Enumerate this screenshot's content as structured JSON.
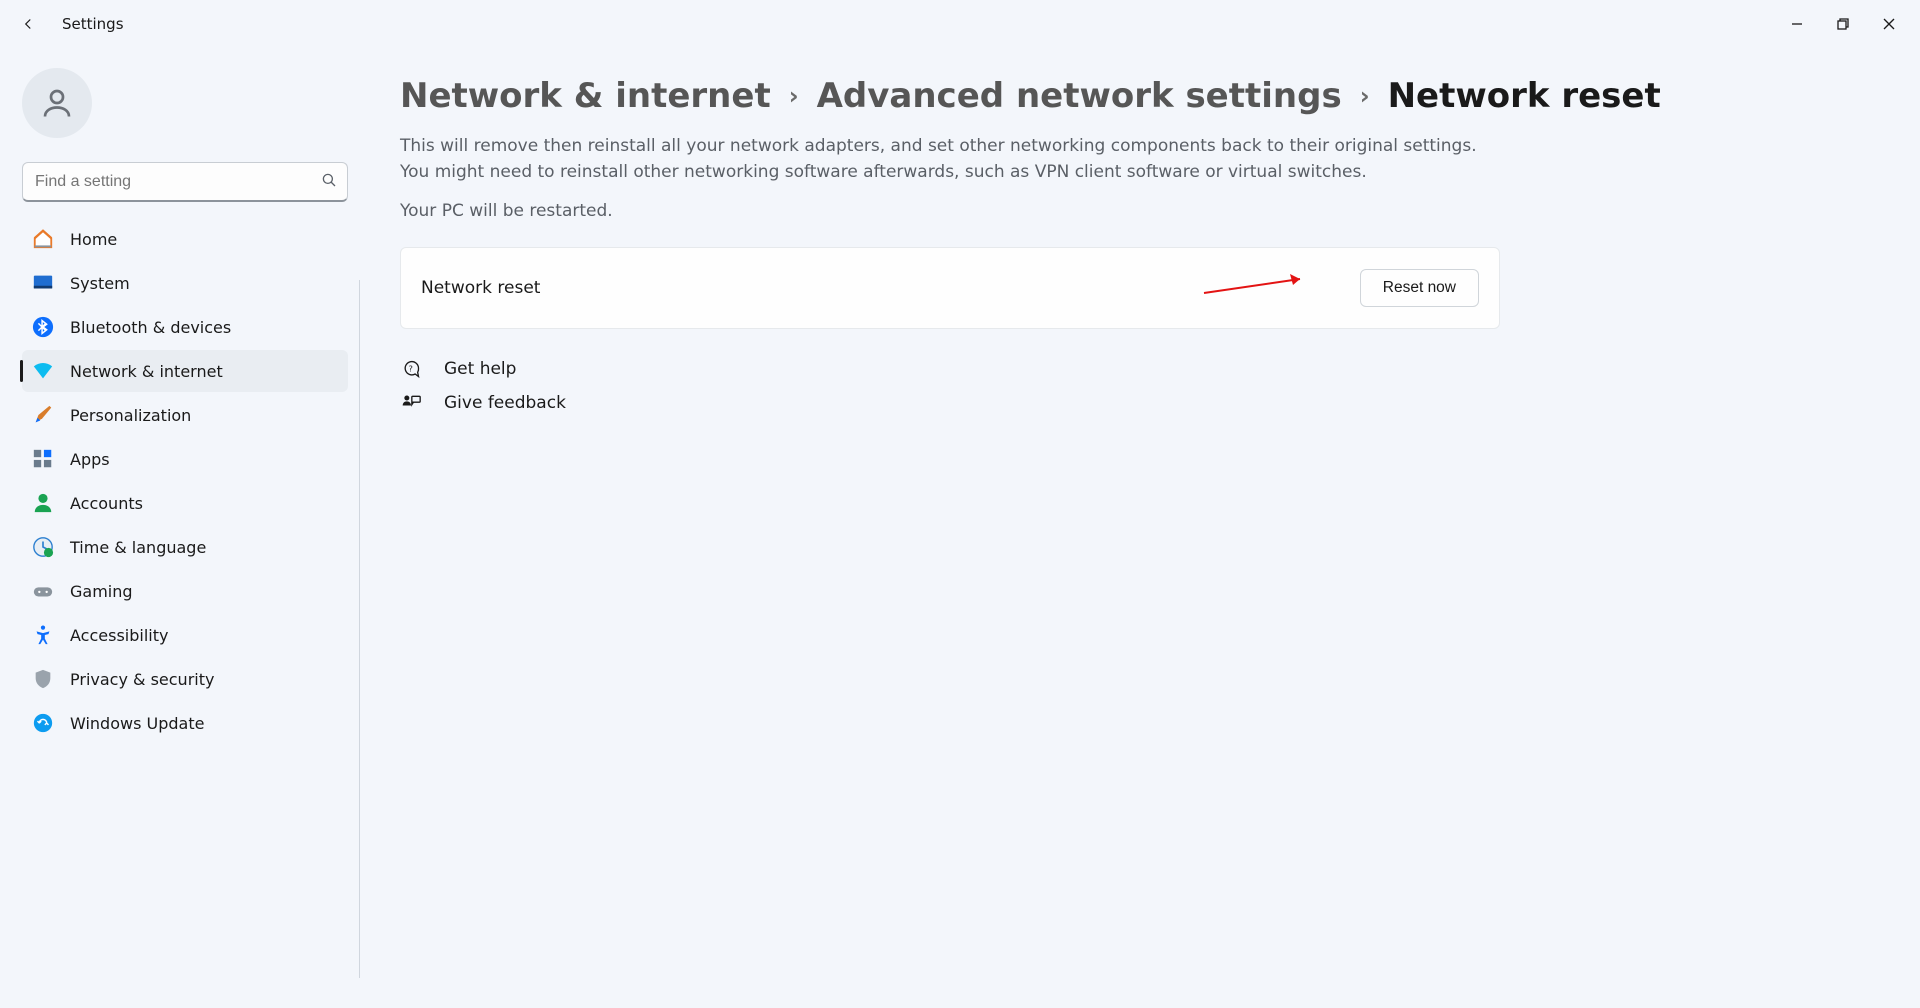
{
  "window": {
    "title": "Settings"
  },
  "search": {
    "placeholder": "Find a setting"
  },
  "nav": {
    "items": [
      {
        "label": "Home"
      },
      {
        "label": "System"
      },
      {
        "label": "Bluetooth & devices"
      },
      {
        "label": "Network & internet"
      },
      {
        "label": "Personalization"
      },
      {
        "label": "Apps"
      },
      {
        "label": "Accounts"
      },
      {
        "label": "Time & language"
      },
      {
        "label": "Gaming"
      },
      {
        "label": "Accessibility"
      },
      {
        "label": "Privacy & security"
      },
      {
        "label": "Windows Update"
      }
    ],
    "active_index": 3
  },
  "breadcrumb": {
    "part1": "Network & internet",
    "part2": "Advanced network settings",
    "current": "Network reset"
  },
  "content": {
    "description": "This will remove then reinstall all your network adapters, and set other networking components back to their original settings. You might need to reinstall other networking software afterwards, such as VPN client software or virtual switches.",
    "restart_note": "Your PC will be restarted.",
    "card_label": "Network reset",
    "reset_button": "Reset now"
  },
  "help": {
    "get_help": "Get help",
    "give_feedback": "Give feedback"
  }
}
